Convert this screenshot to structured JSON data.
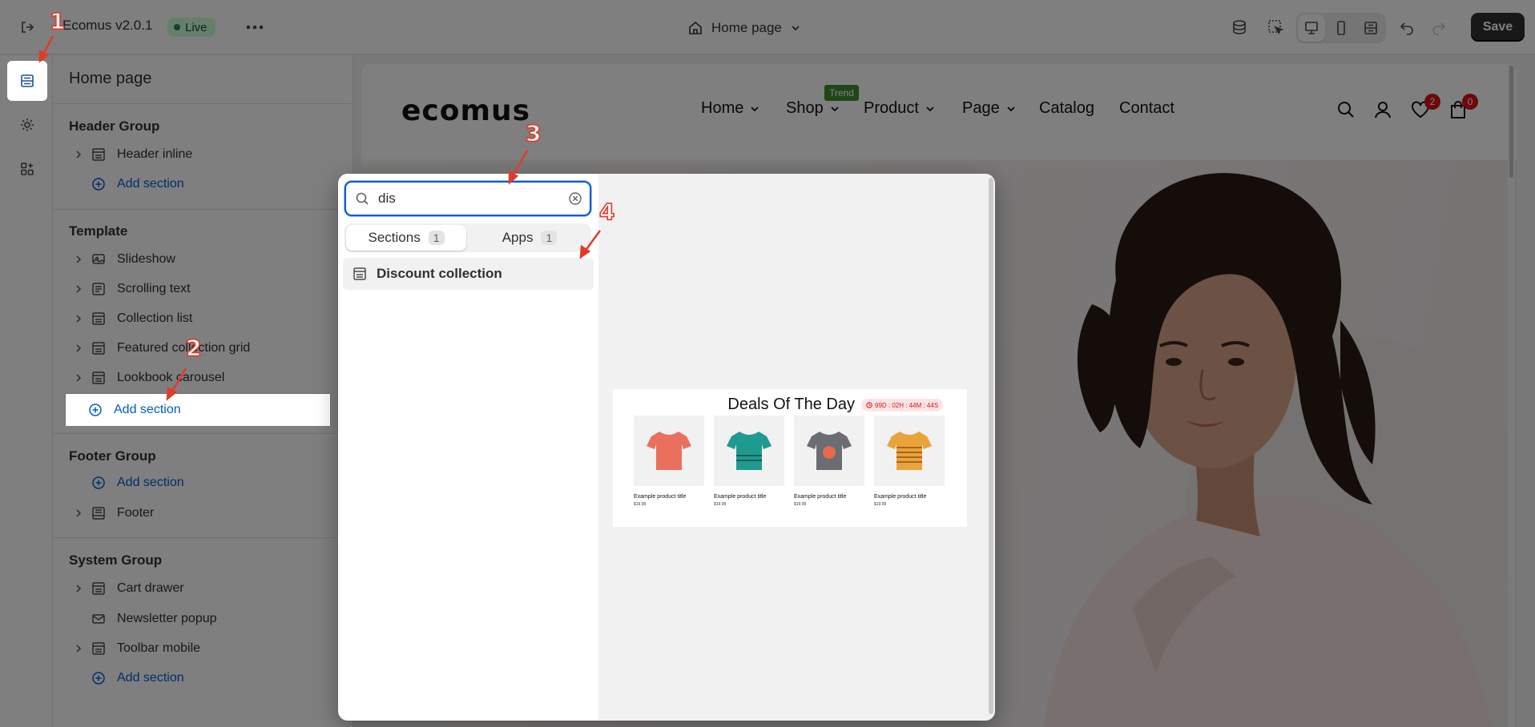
{
  "topbar": {
    "app_title": "Ecomus v2.0.1",
    "live_label": "Live",
    "page_selector": "Home page",
    "save_label": "Save"
  },
  "sidebar": {
    "title": "Home page",
    "groups": [
      {
        "title": "Header Group",
        "items": [
          {
            "label": "Header inline"
          },
          {
            "label": "Add section"
          }
        ]
      },
      {
        "title": "Template",
        "items": [
          {
            "label": "Slideshow"
          },
          {
            "label": "Scrolling text"
          },
          {
            "label": "Collection list"
          },
          {
            "label": "Featured collection grid"
          },
          {
            "label": "Lookbook carousel"
          },
          {
            "label": "Add section"
          }
        ]
      },
      {
        "title": "Footer Group",
        "items": [
          {
            "label": "Add section"
          },
          {
            "label": "Footer"
          }
        ]
      },
      {
        "title": "System Group",
        "items": [
          {
            "label": "Cart drawer"
          },
          {
            "label": "Newsletter popup"
          },
          {
            "label": "Toolbar mobile"
          },
          {
            "label": "Add section"
          }
        ]
      }
    ]
  },
  "store": {
    "logo": "ecomus",
    "nav": [
      {
        "label": "Home"
      },
      {
        "label": "Shop"
      },
      {
        "label": "Product"
      },
      {
        "label": "Page"
      },
      {
        "label": "Catalog"
      },
      {
        "label": "Contact"
      }
    ],
    "trend_badge": "Trend",
    "wishlist_count": "2",
    "cart_count": "0"
  },
  "picker": {
    "search_value": "dis",
    "tabs": [
      {
        "label": "Sections",
        "count": "1"
      },
      {
        "label": "Apps",
        "count": "1"
      }
    ],
    "result": "Discount collection",
    "preview": {
      "title": "Deals Of The Day",
      "timer": "99D : 02H : 44M : 44S",
      "products": [
        {
          "title": "Example product title",
          "price": "$19.99",
          "color": "#e8705c"
        },
        {
          "title": "Example product title",
          "price": "$19.99",
          "color": "#1f9a8f"
        },
        {
          "title": "Example product title",
          "price": "$19.99",
          "color": "#6b6d73"
        },
        {
          "title": "Example product title",
          "price": "$19.99",
          "color": "#e9a33b"
        }
      ]
    }
  },
  "annotations": {
    "m1": "1",
    "m2": "2",
    "m3": "3",
    "m4": "4"
  },
  "colors": {
    "accent": "#005bd3",
    "annotation": "#e03b2a",
    "live": "#29845a"
  },
  "icons": [
    "exit-icon",
    "more-icon",
    "home-icon",
    "chevron-down-icon",
    "database-icon",
    "select-icon",
    "desktop-icon",
    "mobile-icon",
    "fullwidth-icon",
    "undo-icon",
    "redo-icon",
    "sections-icon",
    "gear-icon",
    "apps-icon",
    "search-icon",
    "user-icon",
    "heart-icon",
    "bag-icon",
    "clear-icon"
  ]
}
